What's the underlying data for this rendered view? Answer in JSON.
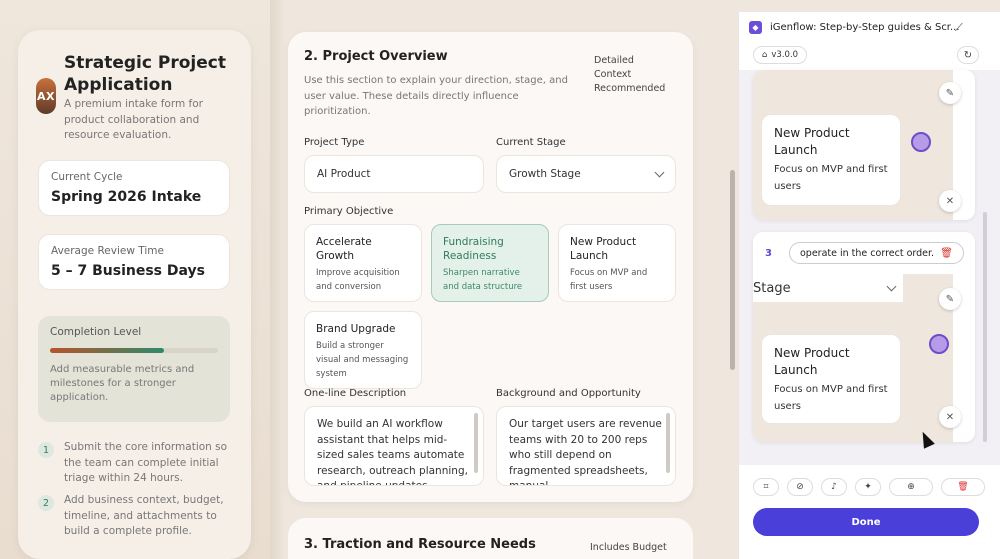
{
  "sidebar": {
    "avatar_initials": "AX",
    "title": "Strategic Project Application",
    "subtitle": "A premium intake form for product collaboration and resource evaluation.",
    "current_cycle": {
      "label": "Current Cycle",
      "value": "Spring 2026 Intake"
    },
    "review_time": {
      "label": "Average Review Time",
      "value": "5 – 7 Business Days"
    },
    "completion": {
      "label": "Completion Level",
      "progress": 0.68,
      "description": "Add measurable metrics and milestones for a stronger application."
    },
    "steps": [
      {
        "num": "1",
        "text": "Submit the core information so the team can complete initial triage within 24 hours."
      },
      {
        "num": "2",
        "text": "Add business context, budget, timeline, and attachments to build a complete profile."
      }
    ]
  },
  "overview": {
    "title": "2. Project Overview",
    "badge": "Detailed Context Recommended",
    "description": "Use this section to explain your direction, stage, and user value. These details directly influence prioritization.",
    "project_type": {
      "label": "Project Type",
      "value": "AI Product"
    },
    "current_stage": {
      "label": "Current Stage",
      "value": "Growth Stage"
    },
    "primary_objective_label": "Primary Objective",
    "objectives": [
      {
        "title": "Accelerate Growth",
        "desc": "Improve acquisition and conversion",
        "selected": false
      },
      {
        "title": "Fundraising Readiness",
        "desc": "Sharpen narrative and data structure",
        "selected": true
      },
      {
        "title": "New Product Launch",
        "desc": "Focus on MVP and first users",
        "selected": false
      },
      {
        "title": "Brand Upgrade",
        "desc": "Build a stronger visual and messaging system",
        "selected": false
      }
    ],
    "one_line": {
      "label": "One-line Description",
      "value": "We build an AI workflow assistant that helps mid-sized sales teams automate research, outreach planning, and pipeline updates"
    },
    "background": {
      "label": "Background and Opportunity",
      "value": "Our target users are revenue teams with 20 to 200 reps who still depend on fragmented spreadsheets, manual"
    }
  },
  "traction": {
    "title": "3. Traction and Resource Needs",
    "badge": "Includes Budget"
  },
  "extension": {
    "title": "iGenflow: Step-by-Step guides & Scr...",
    "version": "v3.0.0",
    "card1": {
      "title": "New Product Launch",
      "desc": "Focus on MVP and first users"
    },
    "step3": {
      "num": "3",
      "instruction": "operate in the correct order."
    },
    "card2_select": "Stage",
    "card2": {
      "title": "New Product Launch",
      "desc": "Focus on MVP and first users"
    },
    "done_label": "Done"
  },
  "colors": {
    "accent": "#4a3fd9",
    "selected_green": "#2e7d5b",
    "dot": "#b79ae8"
  }
}
